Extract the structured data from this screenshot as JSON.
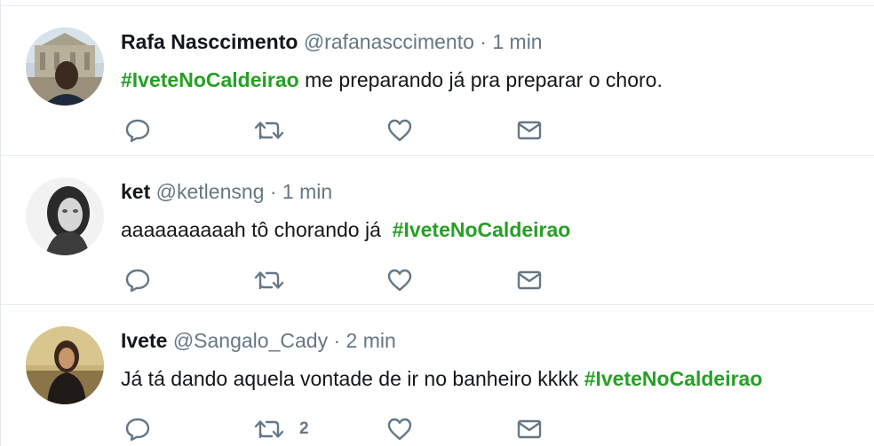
{
  "colors": {
    "hashtag": "#25a025",
    "meta": "#657786",
    "icon": "#657786",
    "divider": "#e6ecf0"
  },
  "tweets": [
    {
      "name": "Rafa Nasccimento",
      "meta": "@rafanasccimento · 1 min",
      "text_parts": [
        "#IveteNoCaldeirao",
        " me preparando já pra preparar o choro."
      ],
      "retweet_count": "",
      "icons": [
        "reply-icon",
        "retweet-icon",
        "like-icon",
        "message-icon"
      ]
    },
    {
      "name": "ket",
      "meta": "@ketlensng · 1 min",
      "text_parts": [
        "aaaaaaaaaah tô chorando já  ",
        "#IveteNoCaldeirao"
      ],
      "retweet_count": "",
      "icons": [
        "reply-icon",
        "retweet-icon",
        "like-icon",
        "message-icon"
      ]
    },
    {
      "name": "Ivete",
      "meta": "@Sangalo_Cady · 2 min",
      "text_parts": [
        "Já tá dando aquela vontade de ir no banheiro kkkk ",
        "#IveteNoCaldeirao"
      ],
      "retweet_count": "2",
      "icons": [
        "reply-icon",
        "retweet-icon",
        "like-icon",
        "message-icon"
      ]
    }
  ]
}
